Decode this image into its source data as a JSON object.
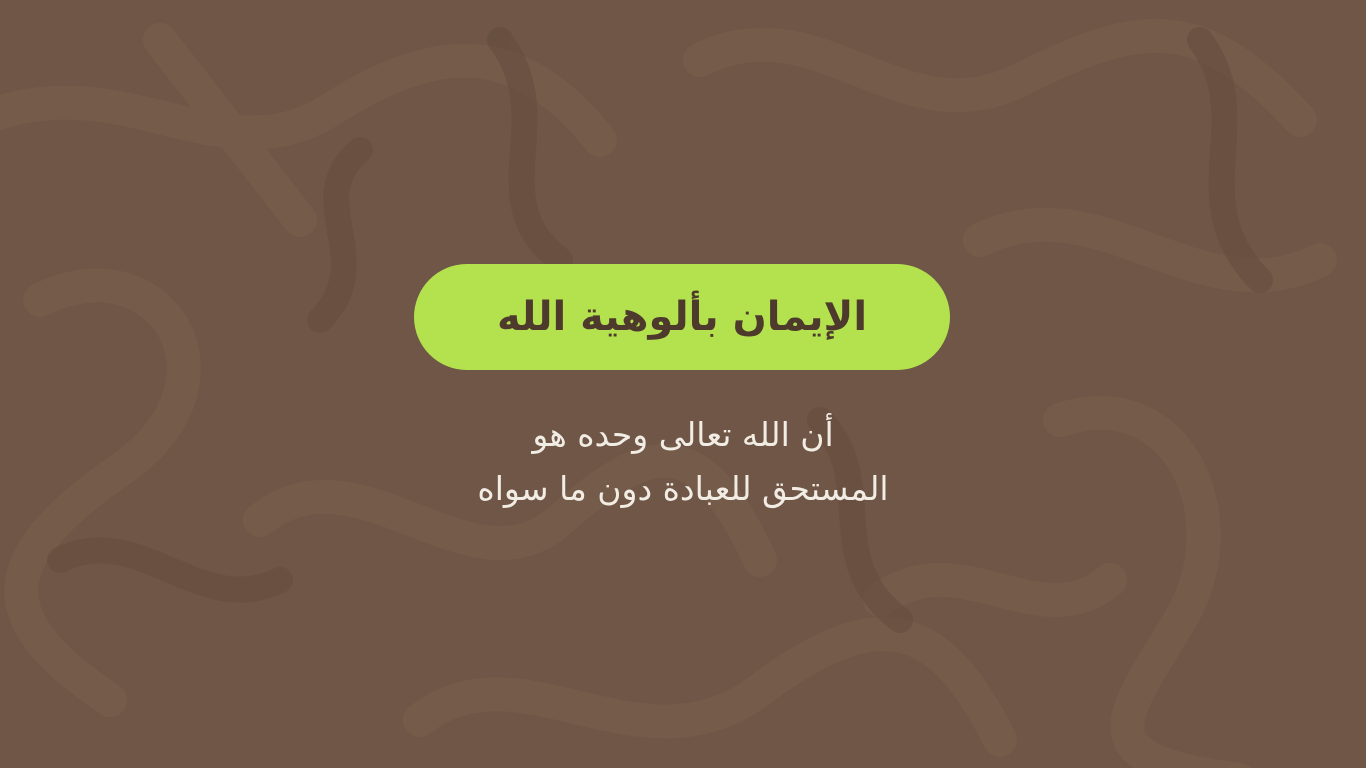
{
  "theme": {
    "background": "#6f5646",
    "accent": "#b3e24e",
    "title_text_color": "#4d3a2d",
    "body_text_color": "#f2ede4"
  },
  "slide": {
    "title": "الإيمان بألوهية الله",
    "description_lines": [
      "أن الله تعالى وحده هو",
      "المستحق للعبادة دون ما سواه"
    ]
  }
}
